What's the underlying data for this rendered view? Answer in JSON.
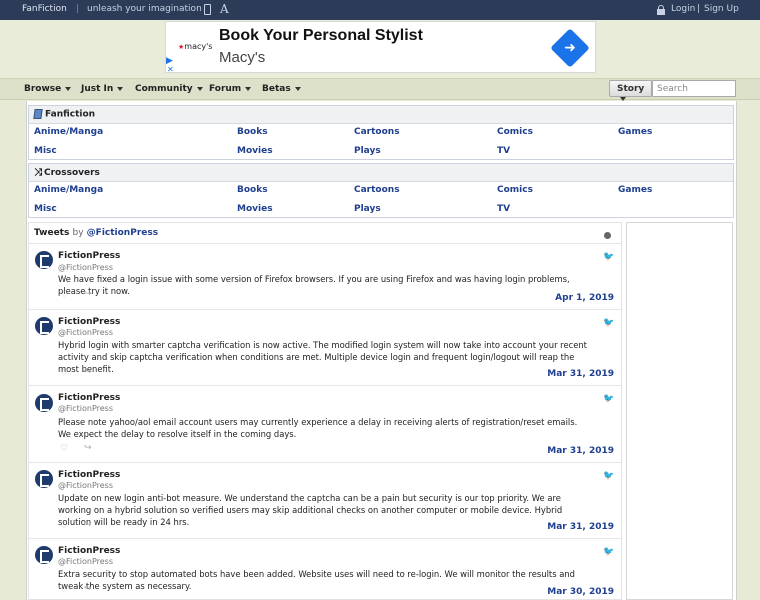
{
  "topbar": {
    "brand": "FanFiction",
    "separator": "|",
    "tagline": "unleash your imagination",
    "login": "Login",
    "divider": "|",
    "signup": "Sign Up"
  },
  "ad": {
    "logo": "macy's",
    "logo_star": "★",
    "headline": "Book Your Personal Stylist",
    "sub": "Macy's",
    "cta_arrow": "➜",
    "adchoices": "▶",
    "close": "✕"
  },
  "nav": {
    "items": [
      {
        "label": "Browse"
      },
      {
        "label": "Just In"
      },
      {
        "label": "Community"
      },
      {
        "label": "Forum"
      },
      {
        "label": "Betas"
      }
    ],
    "story_select": "Story",
    "search_placeholder": "Search"
  },
  "fanfiction": {
    "title": "Fanfiction",
    "categories": [
      "Anime/Manga",
      "Books",
      "Cartoons",
      "Comics",
      "Games",
      "Misc",
      "Movies",
      "Plays",
      "TV"
    ]
  },
  "crossovers": {
    "title": "Crossovers",
    "icon": "⤨",
    "categories": [
      "Anime/Manga",
      "Books",
      "Cartoons",
      "Comics",
      "Games",
      "Misc",
      "Movies",
      "Plays",
      "TV"
    ]
  },
  "tweets_header": {
    "title": "Tweets",
    "by": "by",
    "handle": "@FictionPress"
  },
  "tweet_icons": {
    "heart": "♡",
    "share": "↪",
    "bird": "🐦"
  },
  "tweets": [
    {
      "name": "FictionPress",
      "handle": "@FictionPress",
      "text": "We have fixed a login issue with some version of Firefox browsers. If you are using Firefox and was having login problems, please try it now.",
      "date": "Apr 1, 2019"
    },
    {
      "name": "FictionPress",
      "handle": "@FictionPress",
      "text": "Hybrid login with smarter captcha verification is now active. The modified login system will now take into account your recent activity and skip captcha verification when conditions are met. Multiple device login and frequent login/logout will reap the most benefit.",
      "date": "Mar 31, 2019"
    },
    {
      "name": "FictionPress",
      "handle": "@FictionPress",
      "text": "Please note yahoo/aol email account users may currently experience a delay in receiving alerts of registration/reset emails. We expect the delay to resolve itself in the coming days.",
      "date": "Mar 31, 2019"
    },
    {
      "name": "FictionPress",
      "handle": "@FictionPress",
      "text": "Update on new login anti-bot measure. We understand the captcha can be a pain but security is our top priority. We are working on a hybrid solution so verified users may skip additional checks on another computer or mobile device. Hybrid solution will be ready in 24 hrs.",
      "date": "Mar 31, 2019"
    },
    {
      "name": "FictionPress",
      "handle": "@FictionPress",
      "text": "Extra security to stop automated bots have been added. Website uses will need to re-login. We will monitor the results and tweak the system as necessary.",
      "date": "Mar 30, 2019"
    }
  ]
}
